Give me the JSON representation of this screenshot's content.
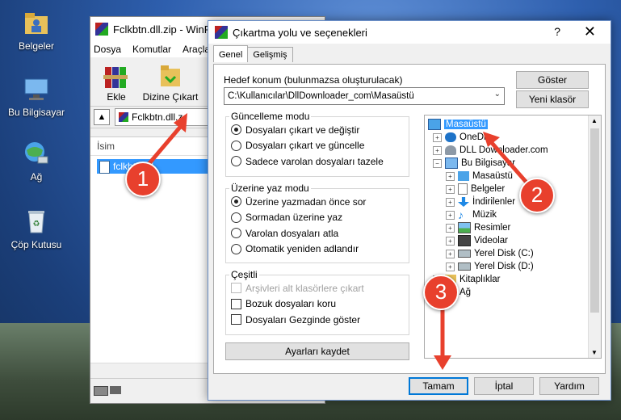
{
  "desktop": {
    "icons": [
      {
        "label": "Belgeler"
      },
      {
        "label": "Bu Bilgisayar"
      },
      {
        "label": "Ağ"
      },
      {
        "label": "Çöp Kutusu"
      }
    ]
  },
  "winrar": {
    "title": "Fclkbtn.dll.zip - WinR",
    "menu": [
      "Dosya",
      "Komutlar",
      "Araçla"
    ],
    "tools": {
      "add": "Ekle",
      "extract": "Dizine Çıkart"
    },
    "path": "Fclkbtn.dll.z",
    "column": "İsim",
    "file": "fclkbtn.dll"
  },
  "dialog": {
    "title": "Çıkartma yolu ve seçenekleri",
    "help": "?",
    "close": "✕",
    "tabs": [
      "Genel",
      "Gelişmiş"
    ],
    "dest_label": "Hedef konum (bulunmazsa oluşturulacak)",
    "dest_value": "C:\\Kullanıcılar\\DllDownloader_com\\Masaüstü",
    "show_button": "Göster",
    "new_folder_button": "Yeni klasör",
    "update_group": {
      "title": "Güncelleme modu",
      "options": [
        "Dosyaları çıkart ve değiştir",
        "Dosyaları çıkart ve güncelle",
        "Sadece varolan dosyaları tazele"
      ],
      "selected": 0
    },
    "overwrite_group": {
      "title": "Üzerine yaz modu",
      "options": [
        "Üzerine yazmadan önce sor",
        "Sormadan üzerine yaz",
        "Varolan dosyaları atla",
        "Otomatik yeniden adlandır"
      ],
      "selected": 0
    },
    "misc_group": {
      "title": "Çeşitli",
      "options": [
        "Arşivleri alt klasörlere çıkart",
        "Bozuk dosyaları koru",
        "Dosyaları Gezginde göster"
      ]
    },
    "save_button": "Ayarları kaydet",
    "tree": [
      {
        "label": "Masaüstü",
        "icon": "desktop-icon"
      },
      {
        "label": "OneDr",
        "icon": "cloud-icon"
      },
      {
        "label": "DLL Downloader.com",
        "icon": "user-icon"
      },
      {
        "label": "Bu Bilgisayar",
        "icon": "computer-icon"
      },
      {
        "label": "Masaüstü",
        "icon": "desktop-icon"
      },
      {
        "label": "Belgeler",
        "icon": "document-icon"
      },
      {
        "label": "İndirilenler",
        "icon": "download-icon"
      },
      {
        "label": "Müzik",
        "icon": "music-icon"
      },
      {
        "label": "Resimler",
        "icon": "picture-icon"
      },
      {
        "label": "Videolar",
        "icon": "video-icon"
      },
      {
        "label": "Yerel Disk (C:)",
        "icon": "drive-icon"
      },
      {
        "label": "Yerel Disk (D:)",
        "icon": "drive-icon"
      },
      {
        "label": "Kitaplıklar",
        "icon": "library-icon"
      },
      {
        "label": "Ağ",
        "icon": "network-icon"
      }
    ],
    "footer": {
      "ok": "Tamam",
      "cancel": "İptal",
      "help": "Yardım"
    }
  },
  "annotations": {
    "step1": "1",
    "step2": "2",
    "step3": "3",
    "accent": "#e8402d"
  }
}
